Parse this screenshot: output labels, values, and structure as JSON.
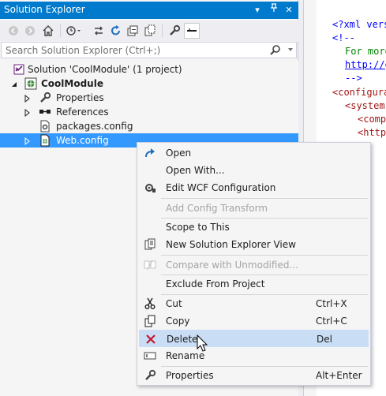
{
  "panel": {
    "title": "Solution Explorer",
    "title_buttons": [
      "▾",
      "⊣",
      "✕"
    ],
    "search_placeholder": "Search Solution Explorer (Ctrl+;)"
  },
  "toolbar": {
    "icons": [
      "back-icon",
      "forward-icon",
      "home-icon",
      "pending-changes-icon",
      "sync-icon",
      "refresh-icon",
      "collapse-all-icon",
      "show-all-files-icon",
      "properties-icon",
      "preview-icon"
    ]
  },
  "tree": {
    "solution": "Solution 'CoolModule' (1 project)",
    "project": "CoolModule",
    "properties": "Properties",
    "references": "References",
    "packages": "packages.config",
    "webconfig": "Web.config"
  },
  "editor": {
    "lines": [
      "<?xml vers",
      "<!--",
      "For more",
      "http://g",
      "-->",
      "<configura",
      "<system.",
      "<compi",
      "<httpR"
    ]
  },
  "context_menu": {
    "open": "Open",
    "open_with": "Open With...",
    "edit_wcf": "Edit WCF Configuration",
    "add_transform": "Add Config Transform",
    "scope_to_this": "Scope to This",
    "new_view": "New Solution Explorer View",
    "compare": "Compare with Unmodified...",
    "exclude": "Exclude From Project",
    "cut": "Cut",
    "cut_key": "Ctrl+X",
    "copy": "Copy",
    "copy_key": "Ctrl+C",
    "delete": "Delete",
    "delete_key": "Del",
    "rename": "Rename",
    "properties": "Properties",
    "properties_key": "Alt+Enter"
  },
  "colors": {
    "accent": "#007acc",
    "selection": "#3399ff",
    "menu_highlight": "#c9def5"
  }
}
